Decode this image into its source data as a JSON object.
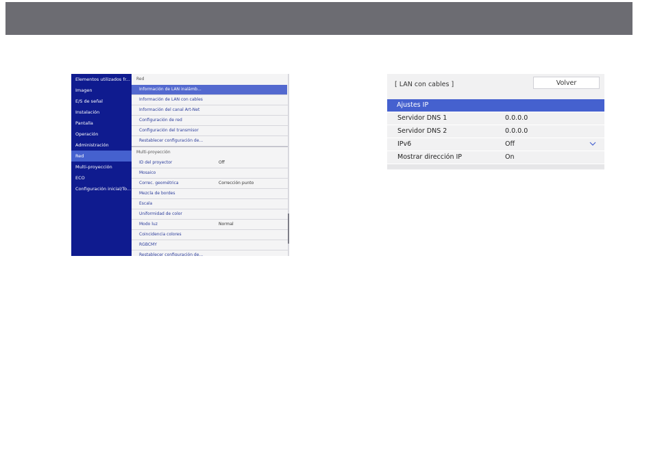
{
  "categories": [
    "Elementos utilizados fr...",
    "Imagen",
    "E/S de señal",
    "Instalación",
    "Pantalla",
    "Operación",
    "Administración",
    "Red",
    "Multi-proyección",
    "ECO",
    "Configuración inicial/To..."
  ],
  "active_category": "Red",
  "red_section": {
    "header": "Red",
    "items": [
      {
        "label": "Información de LAN inalámb..."
      },
      {
        "label": "Información de LAN con cables"
      },
      {
        "label": "Información del canal Art-Net"
      },
      {
        "label": "Configuración de red"
      },
      {
        "label": "Configuración del transmisor"
      },
      {
        "label": "Restablecer configuración de..."
      }
    ]
  },
  "multi_section": {
    "header": "Multi-proyección",
    "items": [
      {
        "label": "ID del proyector",
        "value": "Off"
      },
      {
        "label": "Mosaico",
        "value": ""
      },
      {
        "label": "Correc. geométrica",
        "value": "Corrección punto"
      },
      {
        "label": "Mezcla de bordes",
        "value": ""
      },
      {
        "label": "Escala",
        "value": ""
      },
      {
        "label": "Uniformidad de color",
        "value": ""
      },
      {
        "label": "Modo luz",
        "value": "Normal"
      },
      {
        "label": "Coincidencia colores",
        "value": ""
      },
      {
        "label": "RGBCMY",
        "value": ""
      },
      {
        "label": "Restablecer configuración de...",
        "value": ""
      }
    ]
  },
  "network_panel": {
    "title": "[ LAN con cables ]",
    "back_label": "Volver",
    "rows": [
      {
        "label": "Ajustes IP",
        "value": ""
      },
      {
        "label": "Servidor DNS 1",
        "value": "0.0.0.0"
      },
      {
        "label": "Servidor DNS 2",
        "value": "0.0.0.0"
      },
      {
        "label": "IPv6",
        "value": "Off"
      },
      {
        "label": "Mostrar dirección IP",
        "value": "On"
      }
    ]
  },
  "colors": {
    "top_bar": "#6c6c72",
    "category_bg": "#0f1b8f",
    "highlight": "#4561cf",
    "option_text": "#2a3b9a"
  }
}
